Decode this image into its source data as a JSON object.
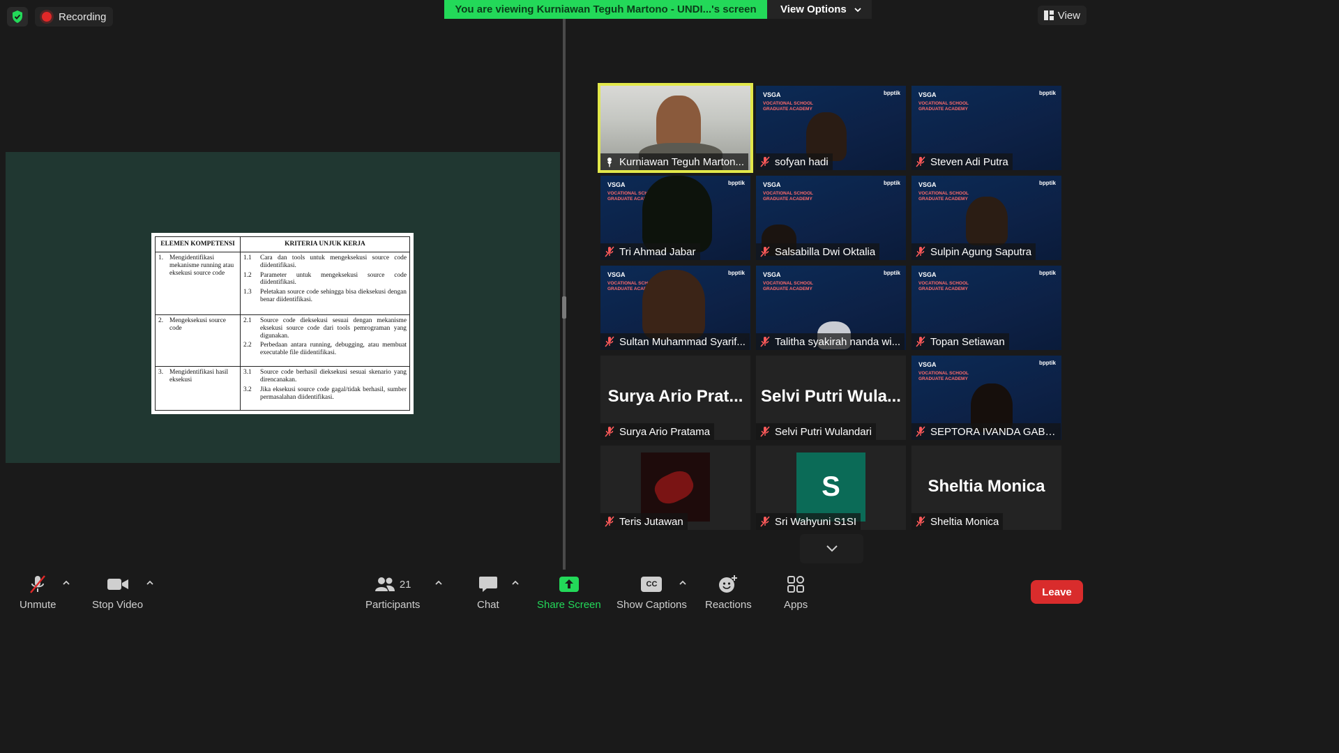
{
  "top_bar": {
    "recording_label": "Recording",
    "viewing_banner": "You are viewing Kurniawan Teguh Martono - UNDI...'s screen",
    "view_options_label": "View Options",
    "view_label": "View"
  },
  "shared_document": {
    "headers": [
      "ELEMEN KOMPETENSI",
      "KRITERIA UNJUK KERJA"
    ],
    "rows": [
      {
        "element_num": "1.",
        "element": "Mengidentifikasi mekanisme running atau eksekusi source code",
        "criteria": [
          {
            "num": "1.1",
            "text": "Cara dan tools untuk mengeksekusi source code diidentifikasi."
          },
          {
            "num": "1.2",
            "text": "Parameter untuk mengeksekusi source code diidentifikasi."
          },
          {
            "num": "1.3",
            "text": "Peletakan source code sehingga bisa dieksekusi dengan benar diidentifikasi."
          }
        ]
      },
      {
        "element_num": "2.",
        "element": "Mengeksekusi source code",
        "criteria": [
          {
            "num": "2.1",
            "text": "Source code dieksekusi sesuai dengan mekanisme eksekusi source code dari tools pemrograman yang digunakan."
          },
          {
            "num": "2.2",
            "text": "Perbedaan antara running, debugging, atau membuat executable file diidentifikasi."
          }
        ]
      },
      {
        "element_num": "3.",
        "element": "Mengidentifikasi hasil eksekusi",
        "criteria": [
          {
            "num": "3.1",
            "text": "Source code berhasil dieksekusi sesuai skenario yang direncanakan."
          },
          {
            "num": "3.2",
            "text": "Jika eksekusi source code gagal/tidak berhasil, sumber permasalahan diidentifikasi."
          }
        ]
      }
    ]
  },
  "vsga_background": {
    "logo": "VSGA",
    "title": "VOCATIONAL SCHOOL GRADUATE ACADEMY",
    "partner": "bpptik"
  },
  "participants": [
    {
      "name": "Kurniawan Teguh Marton...",
      "tile_name": "",
      "active": true,
      "muted": false
    },
    {
      "name": "sofyan hadi",
      "tile_name": "",
      "muted": true
    },
    {
      "name": "Steven Adi Putra",
      "tile_name": "",
      "muted": true
    },
    {
      "name": "Tri Ahmad Jabar",
      "tile_name": "",
      "muted": true
    },
    {
      "name": "Salsabilla Dwi Oktalia",
      "tile_name": "",
      "muted": true
    },
    {
      "name": "Sulpin Agung Saputra",
      "tile_name": "",
      "muted": true
    },
    {
      "name": "Sultan Muhammad Syarif...",
      "tile_name": "",
      "muted": true
    },
    {
      "name": "Talitha syakirah nanda wi...",
      "tile_name": "",
      "muted": true
    },
    {
      "name": "Topan Setiawan",
      "tile_name": "",
      "muted": true
    },
    {
      "name": "Surya Ario Pratama",
      "tile_name": "Surya Ario Prat...",
      "muted": true
    },
    {
      "name": "Selvi Putri Wulandari",
      "tile_name": "Selvi Putri Wula...",
      "muted": true
    },
    {
      "name": "SEPTORA IVANDA GABRA...",
      "tile_name": "",
      "muted": true
    },
    {
      "name": "Teris Jutawan",
      "tile_name": "",
      "muted": true
    },
    {
      "name": "Sri Wahyuni S1SI",
      "tile_name": "",
      "avatar_letter": "S",
      "muted": true
    },
    {
      "name": "Sheltia Monica",
      "tile_name": "Sheltia Monica",
      "muted": true
    }
  ],
  "toolbar": {
    "unmute": "Unmute",
    "stop_video": "Stop Video",
    "participants": "Participants",
    "participants_count": "21",
    "chat": "Chat",
    "share_screen": "Share Screen",
    "show_captions": "Show Captions",
    "cc_icon_text": "CC",
    "reactions": "Reactions",
    "apps": "Apps",
    "leave": "Leave"
  },
  "colors": {
    "accent_green": "#23d959",
    "leave_red": "#d92c2c",
    "active_speaker": "#e2e84a",
    "share_bg": "#203731"
  }
}
